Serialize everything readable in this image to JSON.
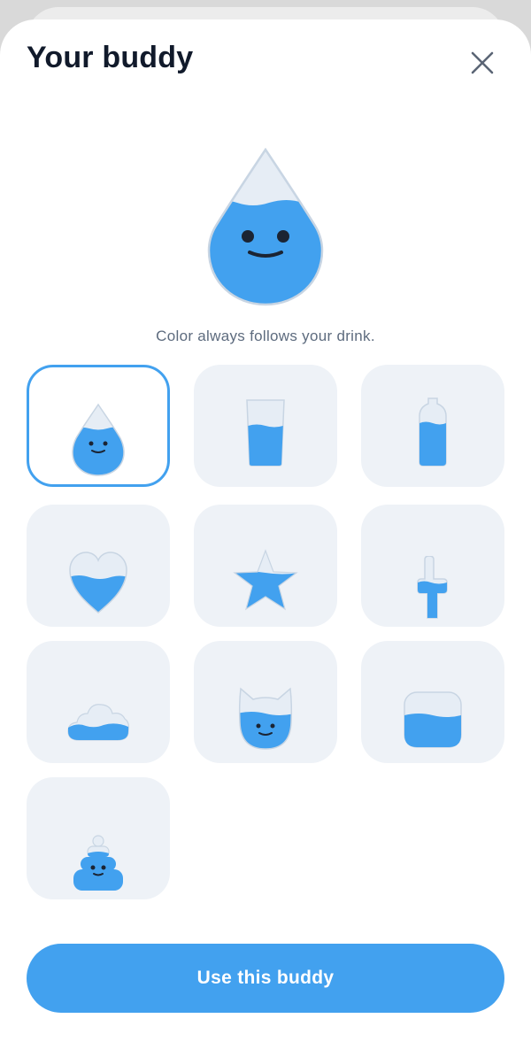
{
  "header": {
    "title": "Your buddy",
    "close_icon": "close-icon"
  },
  "hero": {
    "icon": "water-drop-buddy-icon",
    "caption": "Color always follows your drink."
  },
  "buddies": [
    {
      "name": "water-drop",
      "icon": "water-drop-buddy-icon",
      "selected": true
    },
    {
      "name": "glass",
      "icon": "glass-buddy-icon",
      "selected": false
    },
    {
      "name": "bottle",
      "icon": "bottle-buddy-icon",
      "selected": false
    },
    {
      "name": "heart",
      "icon": "heart-buddy-icon",
      "selected": false
    },
    {
      "name": "star",
      "icon": "star-buddy-icon",
      "selected": false
    },
    {
      "name": "finger",
      "icon": "pointing-finger-buddy-icon",
      "selected": false
    },
    {
      "name": "cloud",
      "icon": "cloud-buddy-icon",
      "selected": false
    },
    {
      "name": "cat",
      "icon": "cat-buddy-icon",
      "selected": false
    },
    {
      "name": "jar",
      "icon": "jar-buddy-icon",
      "selected": false
    },
    {
      "name": "poop",
      "icon": "poop-buddy-icon",
      "selected": false
    }
  ],
  "cta": {
    "label": "Use this buddy"
  },
  "colors": {
    "accent": "#42a1ef",
    "tile_background": "#eef2f7",
    "empty_fill": "#e6edf5",
    "title_text": "#111a2b",
    "caption_text": "#5d6b7e"
  }
}
